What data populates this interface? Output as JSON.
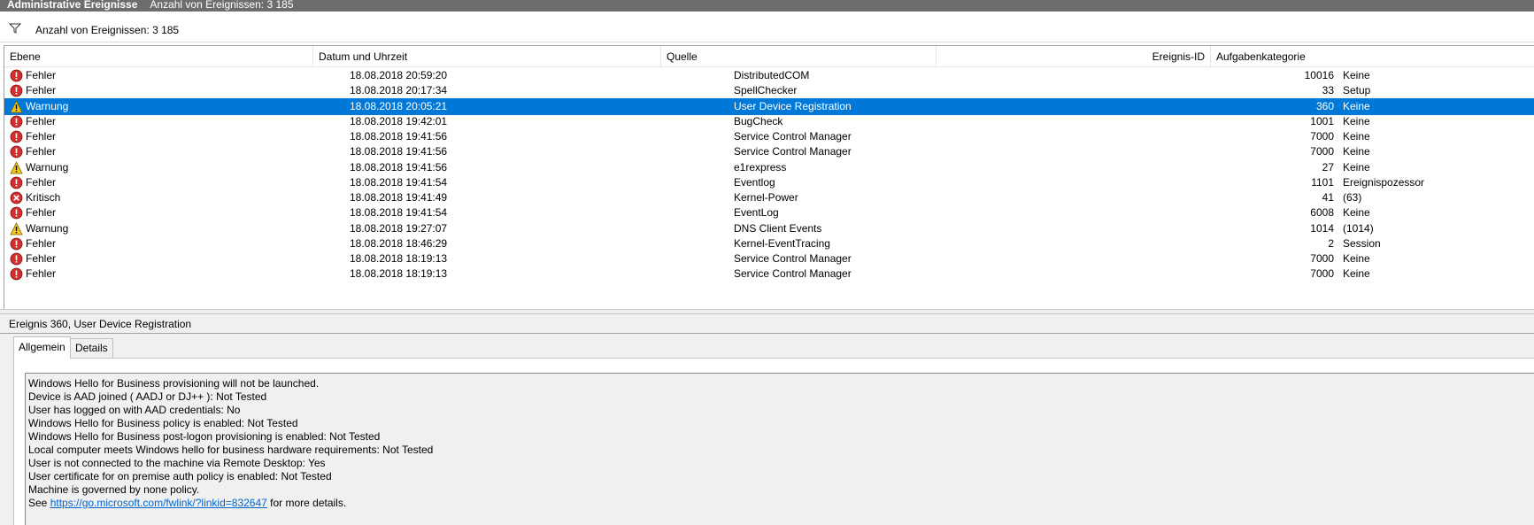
{
  "titlebar": {
    "title": "Administrative Ereignisse",
    "count_text": "Anzahl von Ereignissen: 3 185"
  },
  "filter": {
    "icon": "filter-icon",
    "count_text": "Anzahl von Ereignissen: 3 185"
  },
  "columns": {
    "level": "Ebene",
    "datetime": "Datum und Uhrzeit",
    "source": "Quelle",
    "event_id": "Ereignis-ID",
    "category": "Aufgabenkategorie"
  },
  "level_icons": {
    "Fehler": {
      "icon": "error-icon",
      "color": "#d32f2f"
    },
    "Warnung": {
      "icon": "warning-icon",
      "color": "#f5c518"
    },
    "Kritisch": {
      "icon": "critical-icon",
      "color": "#d32f2f"
    }
  },
  "selection_color": "#0078d7",
  "rows": [
    {
      "level": "Fehler",
      "datetime": "18.08.2018 20:59:20",
      "source": "DistributedCOM",
      "event_id": "10016",
      "category": "Keine"
    },
    {
      "level": "Fehler",
      "datetime": "18.08.2018 20:17:34",
      "source": "SpellChecker",
      "event_id": "33",
      "category": "Setup"
    },
    {
      "level": "Warnung",
      "datetime": "18.08.2018 20:05:21",
      "source": "User Device Registration",
      "event_id": "360",
      "category": "Keine",
      "selected": true
    },
    {
      "level": "Fehler",
      "datetime": "18.08.2018 19:42:01",
      "source": "BugCheck",
      "event_id": "1001",
      "category": "Keine"
    },
    {
      "level": "Fehler",
      "datetime": "18.08.2018 19:41:56",
      "source": "Service Control Manager",
      "event_id": "7000",
      "category": "Keine"
    },
    {
      "level": "Fehler",
      "datetime": "18.08.2018 19:41:56",
      "source": "Service Control Manager",
      "event_id": "7000",
      "category": "Keine"
    },
    {
      "level": "Warnung",
      "datetime": "18.08.2018 19:41:56",
      "source": "e1rexpress",
      "event_id": "27",
      "category": "Keine"
    },
    {
      "level": "Fehler",
      "datetime": "18.08.2018 19:41:54",
      "source": "Eventlog",
      "event_id": "1101",
      "category": "Ereignispozessor"
    },
    {
      "level": "Kritisch",
      "datetime": "18.08.2018 19:41:49",
      "source": "Kernel-Power",
      "event_id": "41",
      "category": "(63)"
    },
    {
      "level": "Fehler",
      "datetime": "18.08.2018 19:41:54",
      "source": "EventLog",
      "event_id": "6008",
      "category": "Keine"
    },
    {
      "level": "Warnung",
      "datetime": "18.08.2018 19:27:07",
      "source": "DNS Client Events",
      "event_id": "1014",
      "category": "(1014)"
    },
    {
      "level": "Fehler",
      "datetime": "18.08.2018 18:46:29",
      "source": "Kernel-EventTracing",
      "event_id": "2",
      "category": "Session"
    },
    {
      "level": "Fehler",
      "datetime": "18.08.2018 18:19:13",
      "source": "Service Control Manager",
      "event_id": "7000",
      "category": "Keine"
    },
    {
      "level": "Fehler",
      "datetime": "18.08.2018 18:19:13",
      "source": "Service Control Manager",
      "event_id": "7000",
      "category": "Keine"
    }
  ],
  "detail": {
    "title": "Ereignis 360, User Device Registration",
    "tabs": [
      {
        "label": "Allgemein",
        "active": true
      },
      {
        "label": "Details",
        "active": false
      }
    ],
    "lines": [
      "Windows Hello for Business provisioning will not be launched.",
      "Device is AAD joined ( AADJ or DJ++ ): Not Tested",
      "User has logged on with AAD credentials: No",
      "Windows Hello for Business policy is enabled: Not Tested",
      "Windows Hello for Business post-logon provisioning is enabled: Not Tested",
      "Local computer meets Windows hello for business hardware requirements: Not Tested",
      "User is not connected to the machine via Remote Desktop: Yes",
      "User certificate for on premise auth policy is enabled: Not Tested",
      "Machine is governed by none policy."
    ],
    "link_line": {
      "prefix": "See ",
      "link": "https://go.microsoft.com/fwlink/?linkid=832647",
      "suffix": " for more details."
    }
  }
}
